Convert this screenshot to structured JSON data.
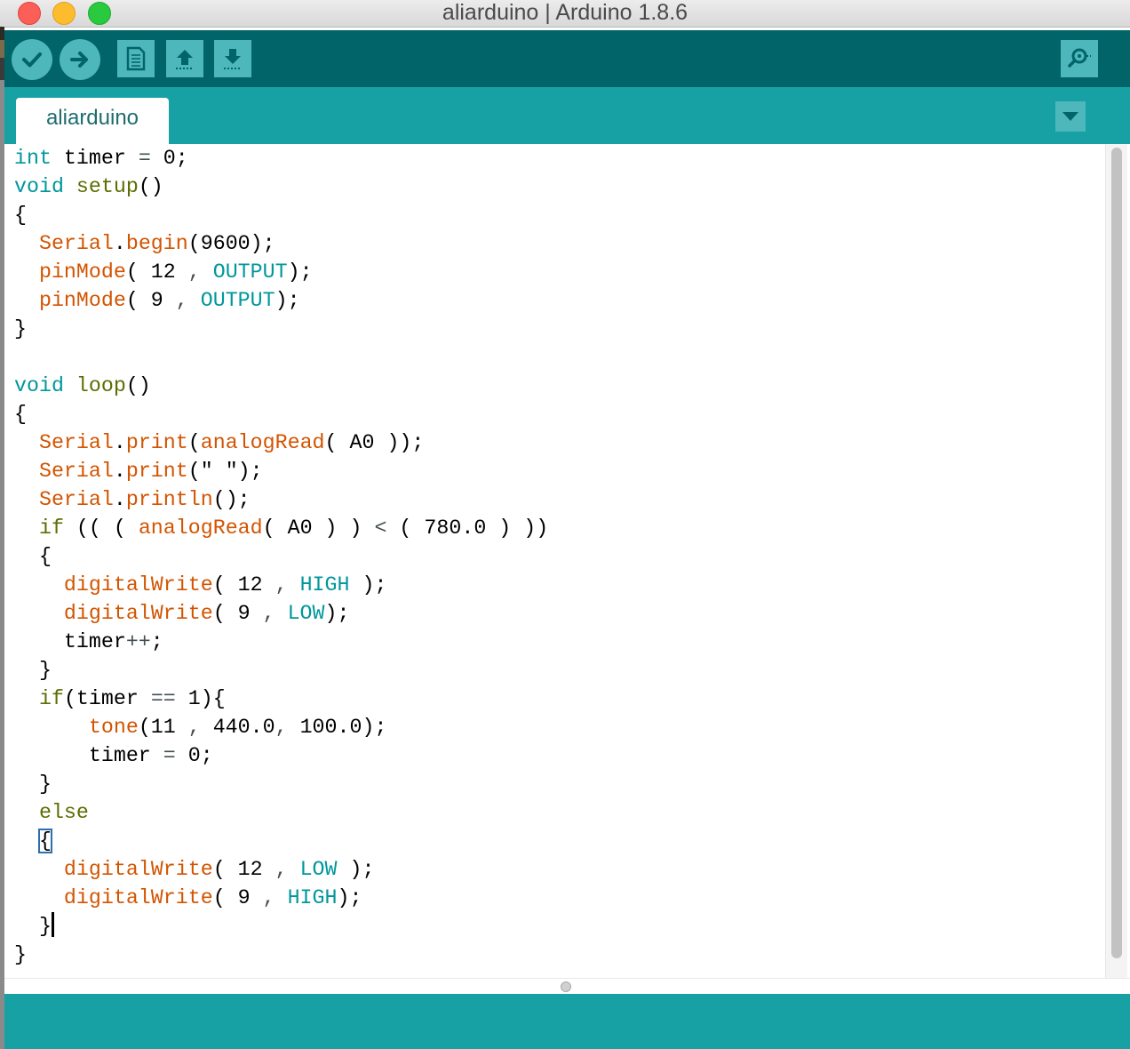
{
  "window": {
    "title": "aliarduino | Arduino 1.8.6"
  },
  "toolbar": {
    "buttons": [
      {
        "name": "verify",
        "icon": "check-icon"
      },
      {
        "name": "upload",
        "icon": "arrow-right-icon"
      },
      {
        "name": "new",
        "icon": "new-file-icon"
      },
      {
        "name": "open",
        "icon": "arrow-up-icon"
      },
      {
        "name": "save",
        "icon": "arrow-down-icon"
      },
      {
        "name": "serial-monitor",
        "icon": "magnifier-icon"
      }
    ]
  },
  "tabs": [
    {
      "label": "aliarduino",
      "active": true
    }
  ],
  "colors": {
    "toolbar": "#006468",
    "tabbar": "#17a1a5",
    "button": "#4db7bb",
    "keyword_type": "#00979c",
    "keyword_control": "#5e6d03",
    "function": "#d35400",
    "constant": "#00979c"
  },
  "editor": {
    "lines": [
      "int timer = 0;",
      "void setup()",
      "{",
      "  Serial.begin(9600);",
      "  pinMode( 12 , OUTPUT);",
      "  pinMode( 9 , OUTPUT);",
      "}",
      "",
      "void loop()",
      "{",
      "  Serial.print(analogRead( A0 ));",
      "  Serial.print(\" \");",
      "  Serial.println();",
      "  if (( ( analogRead( A0 ) ) < ( 780.0 ) ))",
      "  {",
      "    digitalWrite( 12 , HIGH );",
      "    digitalWrite( 9 , LOW);",
      "    timer++;",
      "  }",
      "  if(timer == 1){",
      "      tone(11 , 440.0, 100.0);",
      "      timer = 0;",
      "  }",
      "  else",
      "  {",
      "    digitalWrite( 12 , LOW );",
      "    digitalWrite( 9 , HIGH);",
      "  }",
      "}"
    ]
  }
}
